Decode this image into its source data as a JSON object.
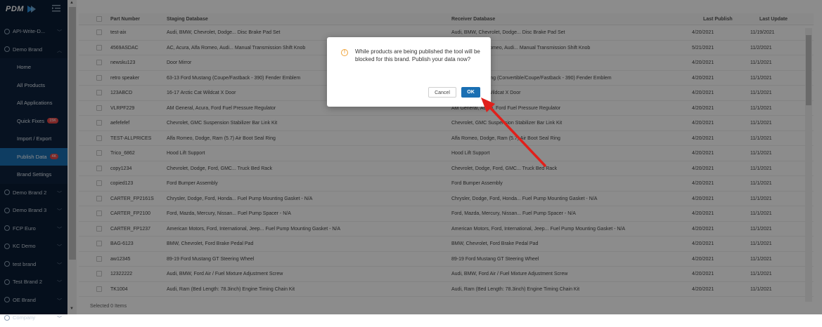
{
  "sidebar": {
    "logo_text": "PDM",
    "items": [
      {
        "label": "API-Write-D...",
        "type": "brand",
        "chev": "﹀"
      },
      {
        "label": "Demo Brand",
        "type": "brand",
        "chev": "︿"
      },
      {
        "label": "Home",
        "type": "sub"
      },
      {
        "label": "All Products",
        "type": "sub"
      },
      {
        "label": "All Applications",
        "type": "sub"
      },
      {
        "label": "Quick Fixes",
        "type": "sub",
        "badge": "15K"
      },
      {
        "label": "Import / Export",
        "type": "sub"
      },
      {
        "label": "Publish Data",
        "type": "sub",
        "badge": "4K",
        "active": true
      },
      {
        "label": "Brand Settings",
        "type": "sub"
      },
      {
        "label": "Demo Brand 2",
        "type": "brand",
        "chev": "﹀"
      },
      {
        "label": "Demo Brand 3",
        "type": "brand",
        "chev": "﹀"
      },
      {
        "label": "FCP Euro",
        "type": "brand",
        "chev": "﹀"
      },
      {
        "label": "KC Demo",
        "type": "brand",
        "chev": "﹀"
      },
      {
        "label": "test brand",
        "type": "brand",
        "chev": "﹀"
      },
      {
        "label": "Test Brand 2",
        "type": "brand",
        "chev": "﹀"
      },
      {
        "label": "OE Brand",
        "type": "brand",
        "chev": "﹀"
      },
      {
        "label": "Company",
        "type": "brand",
        "chev": "﹀"
      }
    ]
  },
  "table": {
    "headers": {
      "part_number": "Part Number",
      "staging": "Staging Database",
      "receiver": "Receiver Database",
      "last_publish": "Last Publish",
      "last_update": "Last Update"
    },
    "rows": [
      [
        "test-aix",
        "Audi, BMW, Chevrolet, Dodge... Disc Brake Pad Set",
        "Audi, BMW, Chevrolet, Dodge... Disc Brake Pad Set",
        "4/20/2021",
        "11/19/2021"
      ],
      [
        "4569ASDAC",
        "AC, Acura, Alfa Romeo, Audi... Manual Transmission Shift Knob",
        "AC, Acura, Alfa Romeo, Audi... Manual Transmission Shift Knob",
        "5/21/2021",
        "11/2/2021"
      ],
      [
        "newsku123",
        "Door Mirror",
        "",
        "4/20/2021",
        "11/1/2021"
      ],
      [
        "retro speaker",
        "63-13 Ford Mustang (Coupe/Fastback - 390) Fender Emblem",
        "63-13 Ford Mustang (Convertible/Coupe/Fastback - 390) Fender Emblem",
        "4/20/2021",
        "11/1/2021"
      ],
      [
        "123ABCD",
        "16-17 Arctic Cat Wildcat X Door",
        "16-17 Arctic Cat Wildcat X Door",
        "4/20/2021",
        "11/1/2021"
      ],
      [
        "VLRPF229",
        "AM General, Acura, Ford Fuel Pressure Regulator",
        "AM General, Acura, Ford Fuel Pressure Regulator",
        "4/20/2021",
        "11/1/2021"
      ],
      [
        "aefefefef",
        "Chevrolet, GMC Suspension Stabilizer Bar Link Kit",
        "Chevrolet, GMC Suspension Stabilizer Bar Link Kit",
        "4/20/2021",
        "11/1/2021"
      ],
      [
        "TEST-ALLPRICES",
        "Alfa Romeo, Dodge, Ram (5.7) Air Boot Seal Ring",
        "Alfa Romeo, Dodge, Ram (5.7) Air Boot Seal Ring",
        "4/20/2021",
        "11/1/2021"
      ],
      [
        "Trico_6862",
        "Hood Lift Support",
        "Hood Lift Support",
        "4/20/2021",
        "11/1/2021"
      ],
      [
        "copy1234",
        "Chevrolet, Dodge, Ford, GMC... Truck Bed Rack",
        "Chevrolet, Dodge, Ford, GMC... Truck Bed Rack",
        "4/20/2021",
        "11/1/2021"
      ],
      [
        "copied123",
        "Ford Bumper Assembly",
        "Ford Bumper Assembly",
        "4/20/2021",
        "11/1/2021"
      ],
      [
        "CARTER_FP2161S",
        "Chrysler, Dodge, Ford, Honda... Fuel Pump Mounting Gasket - N/A",
        "Chrysler, Dodge, Ford, Honda... Fuel Pump Mounting Gasket - N/A",
        "4/20/2021",
        "11/1/2021"
      ],
      [
        "CARTER_FP2100",
        "Ford, Mazda, Mercury, Nissan... Fuel Pump Spacer - N/A",
        "Ford, Mazda, Mercury, Nissan... Fuel Pump Spacer - N/A",
        "4/20/2021",
        "11/1/2021"
      ],
      [
        "CARTER_FP1237",
        "American Motors, Ford, International, Jeep... Fuel Pump Mounting Gasket - N/A",
        "American Motors, Ford, International, Jeep... Fuel Pump Mounting Gasket - N/A",
        "4/20/2021",
        "11/1/2021"
      ],
      [
        "BAG-6123",
        "BMW, Chevrolet, Ford Brake Pedal Pad",
        "BMW, Chevrolet, Ford Brake Pedal Pad",
        "4/20/2021",
        "11/1/2021"
      ],
      [
        "aw12345",
        "89-19 Ford Mustang GT Steering Wheel",
        "89-19 Ford Mustang GT Steering Wheel",
        "4/20/2021",
        "11/1/2021"
      ],
      [
        "12322222",
        "Audi, BMW, Ford Air / Fuel Mixture Adjustment Screw",
        "Audi, BMW, Ford Air / Fuel Mixture Adjustment Screw",
        "4/20/2021",
        "11/1/2021"
      ],
      [
        "TK1004",
        "Audi, Ram (Bed Length: 78.3inch) Engine Timing Chain Kit",
        "Audi, Ram (Bed Length: 78.3inch) Engine Timing Chain Kit",
        "4/20/2021",
        "11/1/2021"
      ]
    ]
  },
  "footer": {
    "selected_text": "Selected 0 Items"
  },
  "modal": {
    "message": "While products are being published the tool will be blocked for this brand. Publish your data now?",
    "cancel_label": "Cancel",
    "ok_label": "OK",
    "warning_glyph": "!"
  },
  "colors": {
    "sidebar_bg": "#0a1c33",
    "accent": "#1a6fb3",
    "badge": "#e54848",
    "arrow": "#e0201b",
    "warning": "#f0a43a"
  }
}
